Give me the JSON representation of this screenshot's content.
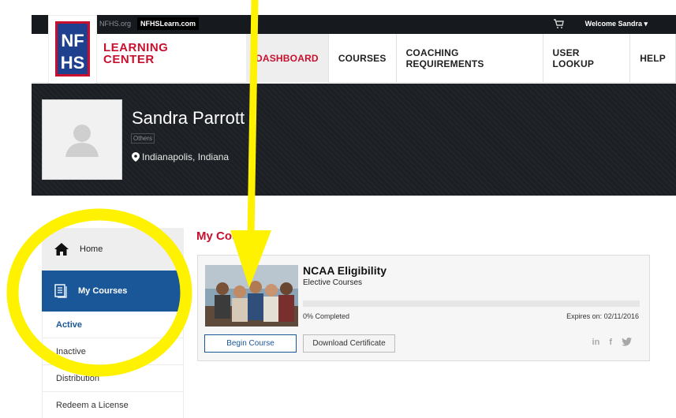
{
  "topbar": {
    "links": [
      "NFHS.org",
      "NFHSLearn.com"
    ],
    "welcome": "Welcome Sandra ▾"
  },
  "brand": {
    "logo_text": "NFHS",
    "line1": "LEARNING",
    "line2": "CENTER"
  },
  "nav": {
    "items": [
      "DASHBOARD",
      "COURSES",
      "COACHING REQUIREMENTS",
      "USER LOOKUP",
      "HELP"
    ]
  },
  "profile": {
    "name": "Sandra Parrott",
    "role": "Others",
    "location": "Indianapolis, Indiana"
  },
  "sidebar": {
    "home": "Home",
    "my_courses": "My Courses",
    "sub_items": [
      "Active",
      "Inactive",
      "Distribution",
      "Redeem a License"
    ]
  },
  "main": {
    "title": "My Courses",
    "course": {
      "name": "NCAA Eligibility",
      "category": "Elective Courses",
      "progress_label": "0% Completed",
      "progress_fraction": 0,
      "expires": "Expires on: 02/11/2016",
      "begin_label": "Begin Course",
      "certificate_label": "Download Certificate",
      "social": [
        "in",
        "f",
        "t"
      ]
    }
  },
  "colors": {
    "brand_red": "#c8102e",
    "accent_blue": "#1a5798",
    "annotation_yellow": "#fff200"
  },
  "icons": [
    "cart-icon",
    "user-silhouette-icon",
    "map-pin-icon",
    "home-icon",
    "courses-icon",
    "linkedin-icon",
    "facebook-icon",
    "twitter-icon"
  ]
}
